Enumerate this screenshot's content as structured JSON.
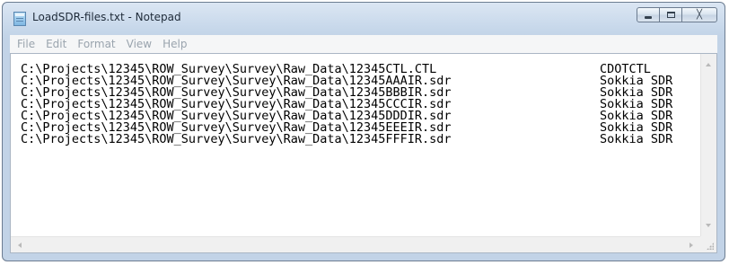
{
  "window": {
    "title": "LoadSDR-files.txt - Notepad",
    "app_icon": "notepad-icon",
    "controls": {
      "minimize_icon": "minimize-icon",
      "maximize_icon": "maximize-icon",
      "close_glyph": "╳"
    }
  },
  "menu": [
    {
      "label": "File"
    },
    {
      "label": "Edit"
    },
    {
      "label": "Format"
    },
    {
      "label": "View"
    },
    {
      "label": "Help"
    }
  ],
  "document": {
    "lines": [
      {
        "path": "C:\\Projects\\12345\\ROW_Survey\\Survey\\Raw_Data\\12345CTL.CTL",
        "type": "CDOTCTL"
      },
      {
        "path": "C:\\Projects\\12345\\ROW_Survey\\Survey\\Raw_Data\\12345AAAIR.sdr",
        "type": "Sokkia SDR"
      },
      {
        "path": "C:\\Projects\\12345\\ROW_Survey\\Survey\\Raw_Data\\12345BBBIR.sdr",
        "type": "Sokkia SDR"
      },
      {
        "path": "C:\\Projects\\12345\\ROW_Survey\\Survey\\Raw_Data\\12345CCCIR.sdr",
        "type": "Sokkia SDR"
      },
      {
        "path": "C:\\Projects\\12345\\ROW_Survey\\Survey\\Raw_Data\\12345DDDIR.sdr",
        "type": "Sokkia SDR"
      },
      {
        "path": "C:\\Projects\\12345\\ROW_Survey\\Survey\\Raw_Data\\12345EEEIR.sdr",
        "type": "Sokkia SDR"
      },
      {
        "path": "C:\\Projects\\12345\\ROW_Survey\\Survey\\Raw_Data\\12345FFFIR.sdr",
        "type": "Sokkia SDR"
      }
    ]
  },
  "colors": {
    "titlebar": "#c6d7ea",
    "menu_text_disabled": "#9aa4ae",
    "editor_bg": "#ffffff"
  }
}
